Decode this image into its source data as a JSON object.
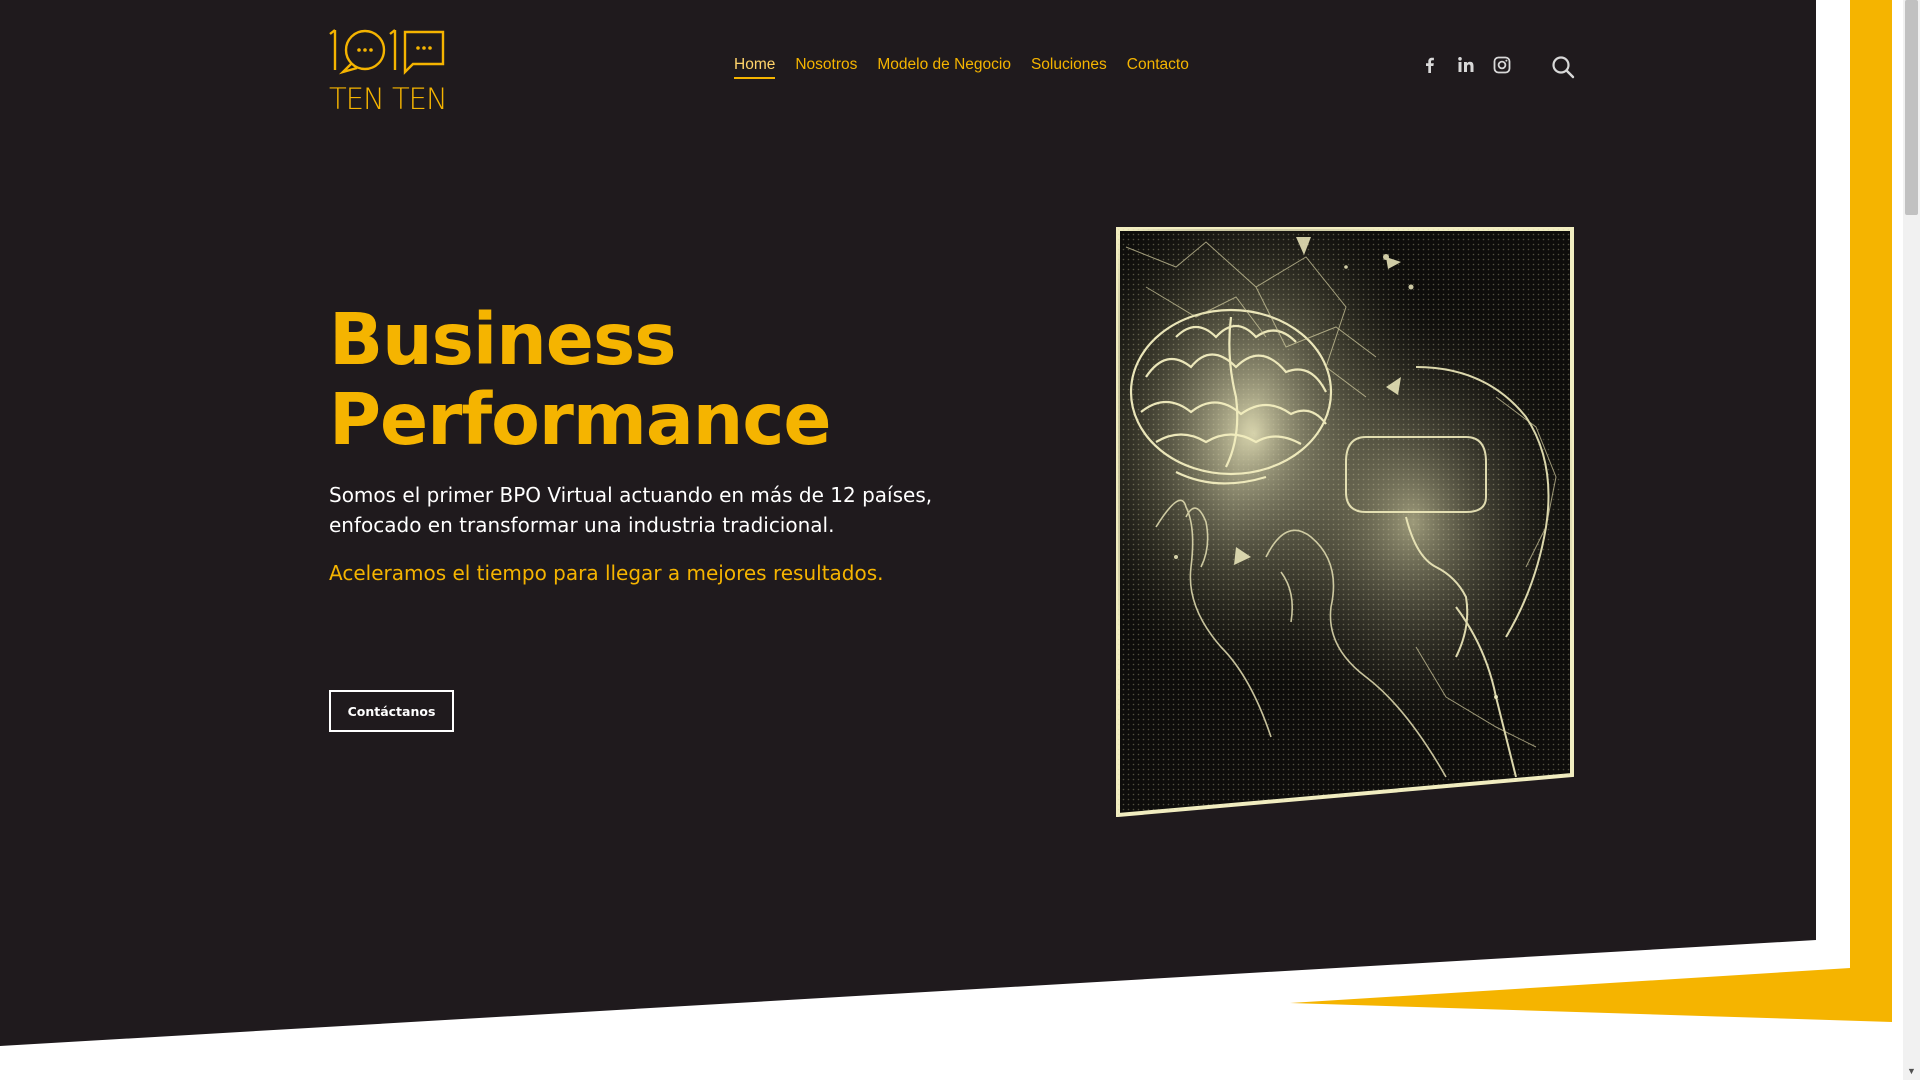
{
  "brand": {
    "logo_text": "TEN TEN",
    "accent_color": "#f5b400",
    "background_color": "#1f1a1d"
  },
  "nav": {
    "items": [
      {
        "label": "Home",
        "active": true
      },
      {
        "label": "Nosotros"
      },
      {
        "label": "Modelo de Negocio"
      },
      {
        "label": "Soluciones"
      },
      {
        "label": "Contacto"
      }
    ]
  },
  "social": {
    "icons": [
      "facebook-icon",
      "linkedin-icon",
      "instagram-icon"
    ]
  },
  "search": {
    "icon": "search-icon"
  },
  "hero": {
    "title_line1": "Business",
    "title_line2": "Performance",
    "description_line1": "Somos el primer BPO Virtual actuando en más de 12 países,",
    "description_line2": "enfocado en transformar una industria tradicional.",
    "tagline": "Aceleramos el tiempo para llegar a mejores resultados.",
    "cta_label": "Contáctanos"
  }
}
